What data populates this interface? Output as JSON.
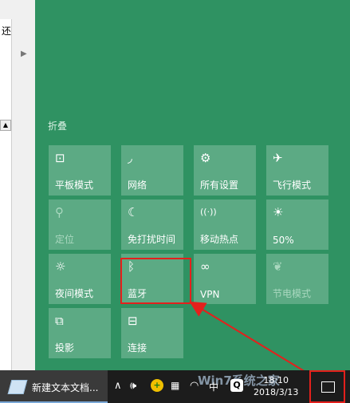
{
  "background_window": {
    "visible_glyph": "还"
  },
  "action_center": {
    "collapse_label": "折叠",
    "tiles": [
      {
        "label": "平板模式",
        "icon": "tablet-mode-icon",
        "glyph": "⊡",
        "state": "on"
      },
      {
        "label": "网络",
        "icon": "network-icon",
        "glyph": "◞",
        "state": "on"
      },
      {
        "label": "所有设置",
        "icon": "gear-icon",
        "glyph": "⚙",
        "state": "on"
      },
      {
        "label": "飞行模式",
        "icon": "airplane-icon",
        "glyph": "✈",
        "state": "on"
      },
      {
        "label": "定位",
        "icon": "location-icon",
        "glyph": "⚲",
        "state": "off"
      },
      {
        "label": "免打扰时间",
        "icon": "moon-icon",
        "glyph": "☾",
        "state": "on"
      },
      {
        "label": "移动热点",
        "icon": "hotspot-icon",
        "glyph": "((·))",
        "state": "on"
      },
      {
        "label": "50%",
        "icon": "brightness-icon",
        "glyph": "☀",
        "state": "on"
      },
      {
        "label": "夜间模式",
        "icon": "night-light-icon",
        "glyph": "☼",
        "state": "on"
      },
      {
        "label": "蓝牙",
        "icon": "bluetooth-icon",
        "glyph": "ᛒ",
        "state": "on"
      },
      {
        "label": "VPN",
        "icon": "vpn-icon",
        "glyph": "∞",
        "state": "on"
      },
      {
        "label": "节电模式",
        "icon": "battery-saver-icon",
        "glyph": "❦",
        "state": "off"
      },
      {
        "label": "投影",
        "icon": "project-icon",
        "glyph": "⧉",
        "state": "on"
      },
      {
        "label": "连接",
        "icon": "connect-icon",
        "glyph": "⊟",
        "state": "on"
      }
    ]
  },
  "taskbar": {
    "app_title": "新建文本文档...",
    "tray": {
      "chevron": "∧",
      "volume": "🕪",
      "ime": "中",
      "q_badge": "Q",
      "plus_badge": "+"
    },
    "clock_time": "18:10",
    "clock_date": "2018/3/13",
    "watermark": "Win7系统之家"
  },
  "colors": {
    "panel": "#2f9262",
    "annotation_red": "#e4201c",
    "taskbar": "#1c1c1c"
  }
}
